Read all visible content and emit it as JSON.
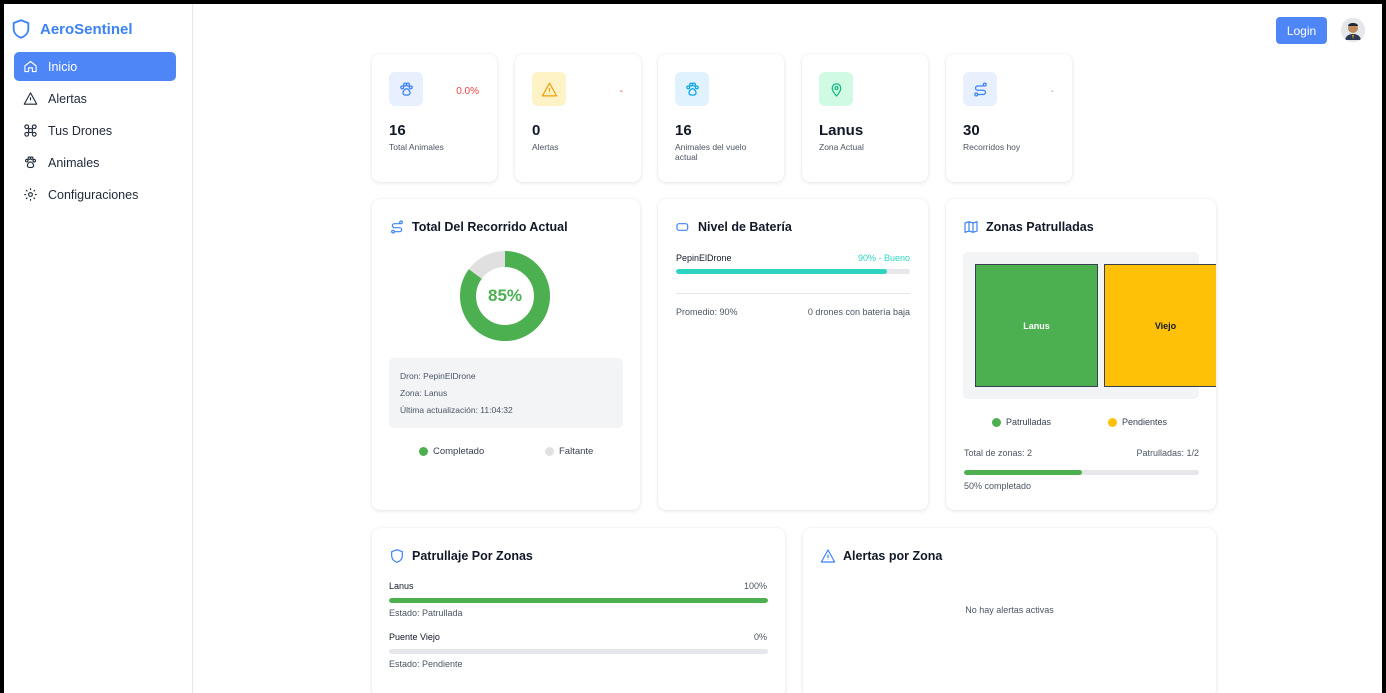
{
  "brand": {
    "name": "AeroSentinel"
  },
  "sidebar": {
    "items": [
      {
        "label": "Inicio",
        "icon": "home-icon",
        "active": true
      },
      {
        "label": "Alertas",
        "icon": "alert-triangle-icon"
      },
      {
        "label": "Tus Drones",
        "icon": "drone-icon"
      },
      {
        "label": "Animales",
        "icon": "paw-icon"
      },
      {
        "label": "Configuraciones",
        "icon": "gear-icon"
      }
    ]
  },
  "header": {
    "login_label": "Login"
  },
  "stats": [
    {
      "value": "16",
      "label": "Total Animales",
      "pct": "0.0%",
      "pct_color": "#ef4444",
      "icon": "paw-icon"
    },
    {
      "value": "0",
      "label": "Alertas",
      "pct": "-",
      "pct_color": "#ef4444",
      "icon": "alert-triangle-icon"
    },
    {
      "value": "16",
      "label": "Animales del vuelo actual",
      "pct": "",
      "icon": "paw-icon"
    },
    {
      "value": "Lanus",
      "label": "Zona Actual",
      "pct": "",
      "icon": "map-pin-icon"
    },
    {
      "value": "30",
      "label": "Recorridos hoy",
      "pct": "-",
      "pct_color": "#9ca3af",
      "icon": "route-icon"
    }
  ],
  "recorrido": {
    "title": "Total Del Recorrido Actual",
    "percent_label": "85%",
    "percent": 85,
    "info": {
      "dron": "Dron: PepinElDrone",
      "zona": "Zona: Lanus",
      "updated": "Última actualización: 11:04:32"
    },
    "legend_done": "Completado",
    "legend_missing": "Faltante",
    "color_done": "#4caf50",
    "color_missing": "#e0e0e0"
  },
  "bateria": {
    "title": "Nivel de Batería",
    "drone": "PepinElDrone",
    "status": "90% - Bueno",
    "level": 0.9,
    "promedio": "Promedio: 90%",
    "low": "0 drones con batería baja",
    "color": "#2dd4bf"
  },
  "zonas": {
    "title": "Zonas Patrulladas",
    "blocks": [
      {
        "name": "Lanus",
        "color": "#4caf50"
      },
      {
        "name": "Viejo",
        "color": "#ffc107"
      }
    ],
    "legend_done": "Patrulladas",
    "legend_pending": "Pendientes",
    "total": "Total de zonas: 2",
    "patrolled": "Patrulladas: 1/2",
    "progress": 0.5,
    "progress_label": "50% completado"
  },
  "patrullaje": {
    "title": "Patrullaje Por Zonas",
    "zones": [
      {
        "name": "Lanus",
        "pct": "100%",
        "level": 1.0,
        "status": "Estado: Patrullada"
      },
      {
        "name": "Puente Viejo",
        "pct": "0%",
        "level": 0.0,
        "status": "Estado: Pendiente"
      }
    ]
  },
  "alertas_zona": {
    "title": "Alertas por Zona",
    "empty": "No hay alertas activas"
  }
}
